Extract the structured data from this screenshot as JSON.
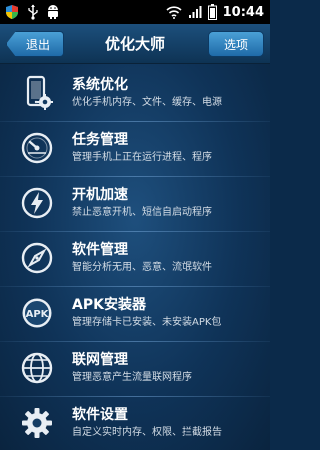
{
  "status_bar": {
    "time": "10:44",
    "icons": [
      "shield-icon",
      "usb-icon",
      "android-icon",
      "wifi-icon",
      "signal-icon",
      "battery-icon"
    ]
  },
  "header": {
    "back_label": "退出",
    "title": "优化大师",
    "options_label": "选项"
  },
  "menu": {
    "items": [
      {
        "label": "系统优化",
        "desc": "优化手机内存、文件、缓存、电源",
        "icon": "phone-gear-icon"
      },
      {
        "label": "任务管理",
        "desc": "管理手机上正在运行进程、程序",
        "icon": "gauge-icon"
      },
      {
        "label": "开机加速",
        "desc": "禁止恶意开机、短信自启动程序",
        "icon": "power-bolt-icon"
      },
      {
        "label": "软件管理",
        "desc": "智能分析无用、恶意、流氓软件",
        "icon": "compass-icon"
      },
      {
        "label": "APK安装器",
        "desc": "管理存储卡已安装、未安装APK包",
        "icon": "apk-icon"
      },
      {
        "label": "联网管理",
        "desc": "管理恶意产生流量联网程序",
        "icon": "globe-icon"
      },
      {
        "label": "软件设置",
        "desc": "自定义实时内存、权限、拦截报告",
        "icon": "settings-gear-icon"
      }
    ]
  },
  "colors": {
    "header_bg": "#1c4f7c",
    "button_bg": "#2f86c4",
    "menu_bg": "#0f3358",
    "status_bar_bg": "#000000"
  }
}
